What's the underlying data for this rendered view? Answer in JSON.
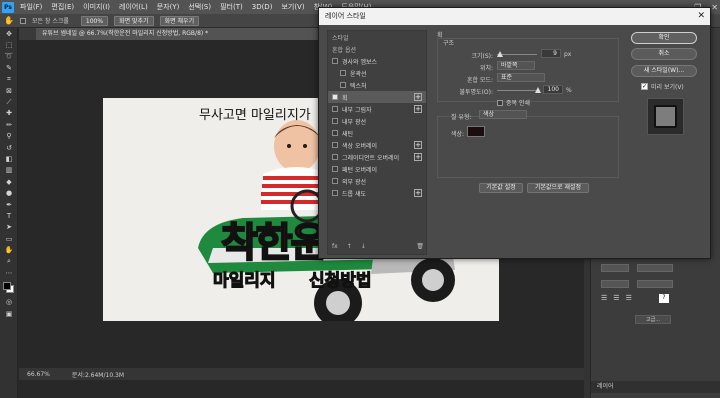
{
  "app": {
    "logo": "Ps",
    "menu": [
      "파일(F)",
      "편집(E)",
      "이미지(I)",
      "레이어(L)",
      "문자(Y)",
      "선택(S)",
      "필터(T)",
      "3D(D)",
      "보기(V)",
      "창(W)",
      "도움말(H)"
    ],
    "window_controls": [
      "—",
      "❐",
      "✕"
    ]
  },
  "options_bar": {
    "label": "모든 창 스크롤",
    "zoom": "100%",
    "fit_screen": "화면 맞추기",
    "fill_screen": "화면 채우기"
  },
  "document": {
    "tab_title": "유튜브 썸네일 @ 66.7%(착한운전 마일리지 신청방법, RGB/8) *",
    "zoom_status": "66.67%",
    "doc_size": "문서:2.64M/10.3M"
  },
  "thumbnail": {
    "top_text": "무사고면 마일리지가",
    "main_text": "착한운",
    "sub_text_1": "마일리지",
    "sub_text_2": "신청방법"
  },
  "dialog": {
    "title": "레이어 스타일",
    "close": "✕",
    "styles_list": [
      {
        "label": "스타일",
        "type": "head"
      },
      {
        "label": "혼합 옵션",
        "type": "head"
      },
      {
        "label": "경사와 엠보스",
        "type": "cb"
      },
      {
        "label": "윤곽선",
        "type": "sub"
      },
      {
        "label": "텍스처",
        "type": "sub"
      },
      {
        "label": "획",
        "type": "cb-checked",
        "plus": true
      },
      {
        "label": "내부 그림자",
        "type": "cb",
        "plus": true
      },
      {
        "label": "내부 광선",
        "type": "cb"
      },
      {
        "label": "새틴",
        "type": "cb"
      },
      {
        "label": "색상 오버레이",
        "type": "cb",
        "plus": true
      },
      {
        "label": "그레이디언트 오버레이",
        "type": "cb",
        "plus": true
      },
      {
        "label": "패턴 오버레이",
        "type": "cb"
      },
      {
        "label": "외부 광선",
        "type": "cb"
      },
      {
        "label": "드롭 섀도",
        "type": "cb",
        "plus": true
      }
    ],
    "bottom_icons": [
      "fx",
      "↑",
      "↓",
      "🗑"
    ],
    "stroke": {
      "section": "획",
      "group": "구조",
      "size_label": "크기(S):",
      "size_value": "9",
      "size_unit": "px",
      "position_label": "위치:",
      "position_value": "바깥쪽",
      "blend_label": "혼합 모드:",
      "blend_value": "표준",
      "opacity_label": "불투명도(O):",
      "opacity_value": "100",
      "opacity_unit": "%",
      "overprint_label": "중복 인쇄",
      "fill_type_label": "칠 유형:",
      "fill_type_value": "색상",
      "color_label": "색상:",
      "color": "#1a0e0e",
      "make_default": "기본값 설정",
      "reset_default": "기본값으로 재설정"
    },
    "buttons": {
      "ok": "확인",
      "cancel": "취소",
      "new_style": "새 스타일(W)...",
      "preview_label": "미리 보기(V)"
    }
  },
  "right_panel": {
    "layers_tab": "레이어",
    "font_size": "T",
    "footer": "고급..."
  },
  "colors": {
    "accent": "#2fa3f7",
    "title_red": "#e5141d",
    "title_yellow": "#ffd200",
    "title_green": "#4fe12a",
    "car_green": "#1f8a3d"
  }
}
